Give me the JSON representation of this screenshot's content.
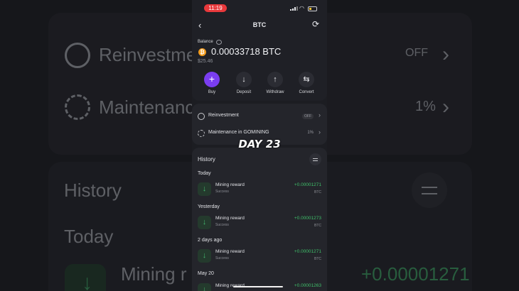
{
  "status_bar": {
    "time": "11:19"
  },
  "nav": {
    "title": "BTC"
  },
  "balance": {
    "label": "Balance",
    "coin_symbol": "₿",
    "amount": "0.00033718 BTC",
    "fiat": "$25.46"
  },
  "actions": [
    {
      "label": "Buy",
      "icon": "plus-icon"
    },
    {
      "label": "Deposit",
      "icon": "arrow-down-icon"
    },
    {
      "label": "Withdraw",
      "icon": "arrow-up-icon"
    },
    {
      "label": "Convert",
      "icon": "swap-icon"
    }
  ],
  "settings": {
    "reinvestment": {
      "label": "Reinvestment",
      "state": "OFF"
    },
    "maintenance": {
      "label": "Maintenance in GOMINING",
      "value": "1%"
    }
  },
  "overlay": {
    "text": "DAY 23"
  },
  "history": {
    "title": "History",
    "groups": [
      {
        "date": "Today",
        "name": "Mining reward",
        "status": "Success",
        "amount": "+0.00001271",
        "currency": "BTC"
      },
      {
        "date": "Yesterday",
        "name": "Mining reward",
        "status": "Success",
        "amount": "+0.00001273",
        "currency": "BTC"
      },
      {
        "date": "2 days ago",
        "name": "Mining reward",
        "status": "Success",
        "amount": "+0.00001271",
        "currency": "BTC"
      },
      {
        "date": "May 20",
        "name": "Mining reward",
        "status": "",
        "amount": "+0.00001263",
        "currency": ""
      }
    ]
  },
  "background": {
    "reinvestment": "Reinvestme",
    "off": "OFF",
    "maintenance": "Maintenanc",
    "pct": "1%",
    "history": "History",
    "today": "Today",
    "mining": "Mining r",
    "amount": "+0.00001271"
  },
  "colors": {
    "accent": "#7a3df0",
    "positive": "#3fbf6a",
    "coin": "#f39c1d",
    "record": "#e8383b"
  }
}
